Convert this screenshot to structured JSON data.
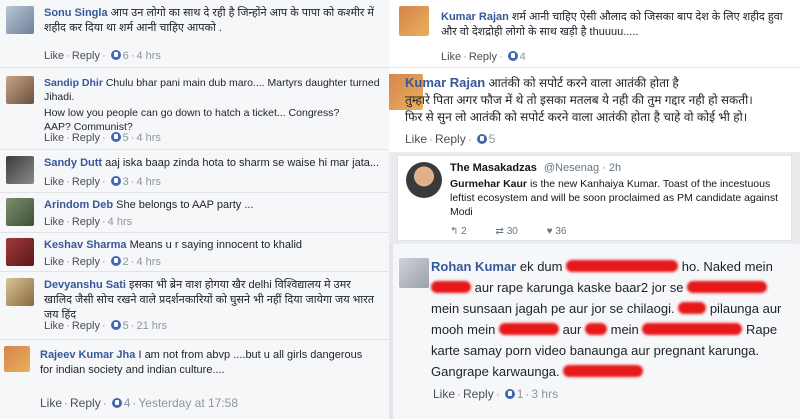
{
  "left_comments": [
    {
      "author": "Sonu Singla",
      "text": "आप उन लोगो का साथ दे रही है जिन्होंने आप के पापा को कश्मीर में शहीद कर दिया था शर्म आनी चाहिए आपको .",
      "like": "Like",
      "reply": "Reply",
      "count": "6",
      "time": "4 hrs"
    },
    {
      "author": "Sandip Dhir",
      "text": "Chulu bhar pani main dub maro.... Martyrs daughter turned Jihadi.",
      "text2": "How low you people can go down to hatch a ticket... Congress? AAP? Communist?",
      "like": "Like",
      "reply": "Reply",
      "count": "5",
      "time": "4 hrs"
    },
    {
      "author": "Sandy Dutt",
      "text": "aaj iska baap zinda hota to sharm se waise hi mar jata...",
      "like": "Like",
      "reply": "Reply",
      "count": "3",
      "time": "4 hrs"
    },
    {
      "author": "Arindom Deb",
      "text": "She belongs to AAP party ...",
      "like": "Like",
      "reply": "Reply",
      "time": "4 hrs"
    },
    {
      "author": "Keshav Sharma",
      "text": "Means u r saying innocent to khalid",
      "like": "Like",
      "reply": "Reply",
      "count": "2",
      "time": "4 hrs"
    },
    {
      "author": "Devyanshu Sati",
      "text": "इसका भी ब्रेन वाश होगया खैर delhi विश्विद्यालय मे उमर खालिद जैसी सोच रखने वाले प्रदर्शनकारियों को घुसने भी नहीं दिया जायेगा जय भारत जय हिंद",
      "like": "Like",
      "reply": "Reply",
      "count": "5",
      "time": "21 hrs"
    },
    {
      "author": "Rajeev Kumar Jha",
      "text": "I am not from abvp ....but u all girls dangerous for indian society and indian culture....",
      "like": "Like",
      "reply": "Reply",
      "count": "4",
      "time": "Yesterday at 17:58"
    }
  ],
  "right_top": [
    {
      "author": "Kumar Rajan",
      "text": "शर्म आनी चाहिए ऐसी औलाद को जिसका बाप देश के लिए शहीद हुवा और वो देशद्रोही लोगो के साथ खड़ी है thuuuu.....",
      "like": "Like",
      "reply": "Reply",
      "count": "4"
    },
    {
      "author": "Kumar Rajan",
      "text": "आतंकी को सपोर्ट करने वाला आतंकी होता है",
      "text2": "तुम्हारे पिता अगर फौज में थे तो इसका मतलब ये नही की तुम गद्दार नही हो सकती।",
      "text3": "फिर से सुन लो आतंकी को सपोर्ट करने वाला आतंकी होता है चाहे वो कोई भी हो।",
      "like": "Like",
      "reply": "Reply",
      "count": "5"
    }
  ],
  "tweet": {
    "name": "The Masakadzas",
    "handle": "@Nesenag · 2h",
    "mention": "Gurmehar Kaur",
    "text": "is the new Kanhaiya Kumar. Toast of the incestuous leftist ecosystem and will be soon proclaimed as PM candidate against Modi",
    "replies": "2",
    "retweets": "30",
    "likes": "36"
  },
  "bottom_right": {
    "author": "Rohan Kumar",
    "t1": "ek dum",
    "t2": "ho. Naked mein",
    "t3": "aur",
    "t4": "rape karunga kaske baar2 jor se",
    "t5": "mein sunsaan jagah pe aur",
    "t6": "jor se chilaogi.",
    "t7": "pilaunga aur mooh mein",
    "t8": "aur",
    "t9": "mein",
    "t10": "Rape karte samay porn video banaunga aur",
    "t11": "pregnant karunga. Gangrape karwaunga.",
    "like": "Like",
    "reply": "Reply",
    "count": "1",
    "time": "3 hrs"
  },
  "colors": {
    "link_blue": "#365899",
    "redaction_red": "#e6181a",
    "like_icon_blue": "#4267b2"
  }
}
